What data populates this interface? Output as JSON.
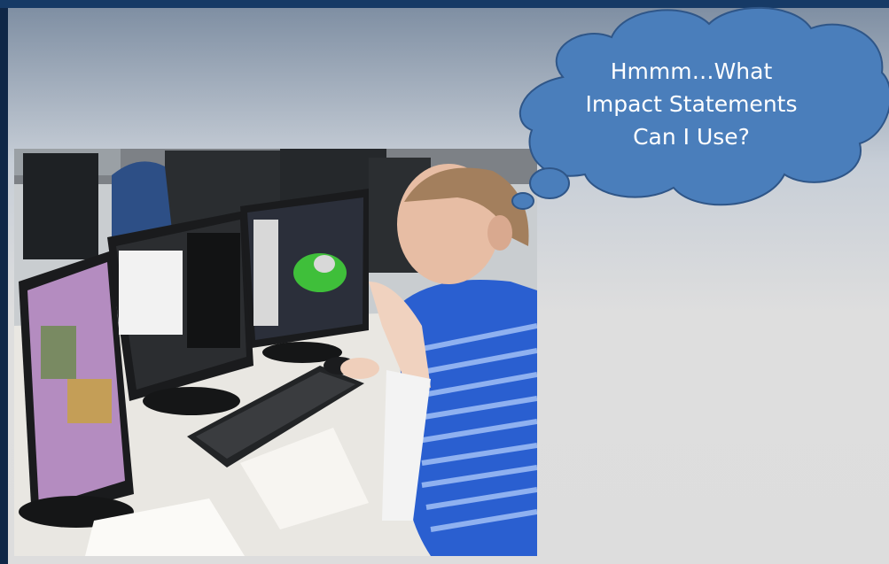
{
  "slide": {
    "thought_bubble": {
      "lines": [
        "Hmmm…What",
        "Impact Statements",
        "Can I Use?"
      ]
    },
    "photo": {
      "subject": "forecaster-at-workstation"
    }
  },
  "colors": {
    "frame": "#0f2747",
    "cloud_fill": "#4a7ebb",
    "cloud_stroke": "#2f5688",
    "shirt": "#2a5fd0"
  }
}
